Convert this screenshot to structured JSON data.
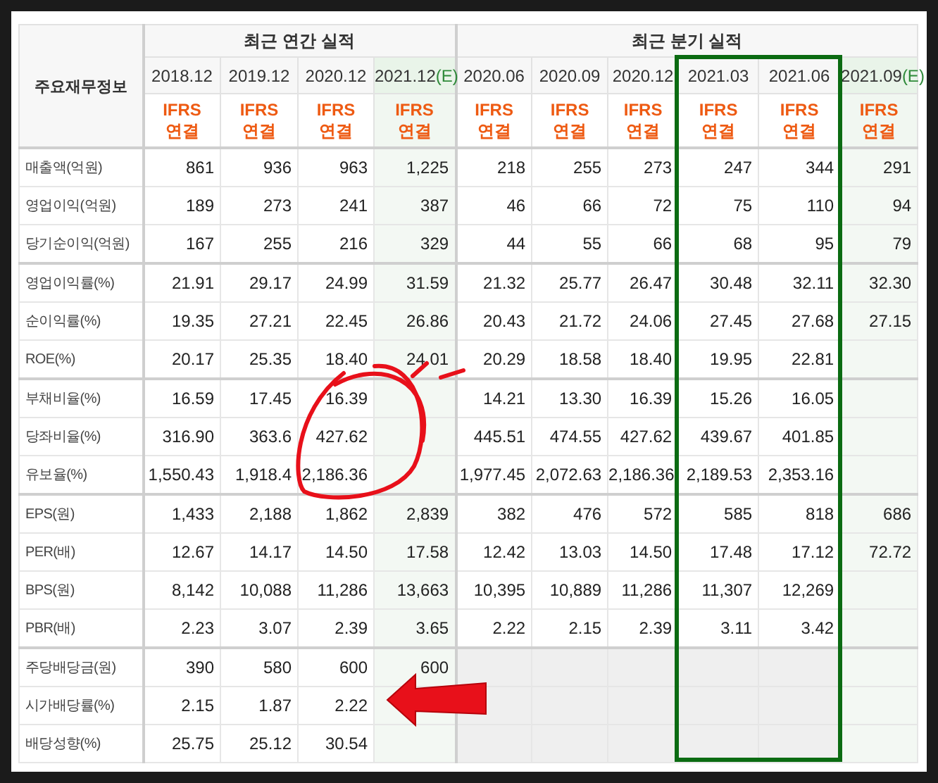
{
  "table": {
    "corner_label": "주요재무정보",
    "groups": [
      {
        "label": "최근 연간 실적",
        "columns": [
          {
            "period": "2018.12",
            "basis": "IFRS",
            "scope": "연결"
          },
          {
            "period": "2019.12",
            "basis": "IFRS",
            "scope": "연결"
          },
          {
            "period": "2020.12",
            "basis": "IFRS",
            "scope": "연결"
          },
          {
            "period": "2021.12",
            "estimate": true,
            "estimate_mark": "(E)",
            "basis": "IFRS",
            "scope": "연결"
          }
        ]
      },
      {
        "label": "최근 분기 실적",
        "columns": [
          {
            "period": "2020.06",
            "basis": "IFRS",
            "scope": "연결"
          },
          {
            "period": "2020.09",
            "basis": "IFRS",
            "scope": "연결"
          },
          {
            "period": "2020.12",
            "basis": "IFRS",
            "scope": "연결"
          },
          {
            "period": "2021.03",
            "boxed": true,
            "basis": "IFRS",
            "scope": "연결"
          },
          {
            "period": "2021.06",
            "boxed": true,
            "basis": "IFRS",
            "scope": "연결"
          },
          {
            "period": "2021.09",
            "estimate": true,
            "estimate_mark": "(E)",
            "basis": "IFRS",
            "scope": "연결"
          }
        ]
      }
    ],
    "sections": [
      {
        "rows": [
          {
            "label": "매출액(억원)",
            "values": [
              [
                "861",
                "936",
                "963",
                "1,225"
              ],
              [
                "218",
                "255",
                "273",
                "247",
                "344",
                "291"
              ]
            ]
          },
          {
            "label": "영업이익(억원)",
            "values": [
              [
                "189",
                "273",
                "241",
                "387"
              ],
              [
                "46",
                "66",
                "72",
                "75",
                "110",
                "94"
              ]
            ]
          },
          {
            "label": "당기순이익(억원)",
            "values": [
              [
                "167",
                "255",
                "216",
                "329"
              ],
              [
                "44",
                "55",
                "66",
                "68",
                "95",
                "79"
              ]
            ]
          }
        ]
      },
      {
        "rows": [
          {
            "label": "영업이익률(%)",
            "values": [
              [
                "21.91",
                "29.17",
                "24.99",
                "31.59"
              ],
              [
                "21.32",
                "25.77",
                "26.47",
                "30.48",
                "32.11",
                "32.30"
              ]
            ]
          },
          {
            "label": "순이익률(%)",
            "values": [
              [
                "19.35",
                "27.21",
                "22.45",
                "26.86"
              ],
              [
                "20.43",
                "21.72",
                "24.06",
                "27.45",
                "27.68",
                "27.15"
              ]
            ]
          },
          {
            "label": "ROE(%)",
            "values": [
              [
                "20.17",
                "25.35",
                "18.40",
                "24.01"
              ],
              [
                "20.29",
                "18.58",
                "18.40",
                "19.95",
                "22.81"
              ]
            ]
          }
        ]
      },
      {
        "rows": [
          {
            "label": "부채비율(%)",
            "values": [
              [
                "16.59",
                "17.45",
                "16.39"
              ],
              [
                "14.21",
                "13.30",
                "16.39",
                "15.26",
                "16.05"
              ]
            ]
          },
          {
            "label": "당좌비율(%)",
            "values": [
              [
                "316.90",
                "363.6",
                "427.62"
              ],
              [
                "445.51",
                "474.55",
                "427.62",
                "439.67",
                "401.85"
              ]
            ]
          },
          {
            "label": "유보율(%)",
            "values": [
              [
                "1,550.43",
                "1,918.4",
                "2,186.36"
              ],
              [
                "1,977.45",
                "2,072.63",
                "2,186.36",
                "2,189.53",
                "2,353.16"
              ]
            ]
          }
        ]
      },
      {
        "rows": [
          {
            "label": "EPS(원)",
            "values": [
              [
                "1,433",
                "2,188",
                "1,862",
                "2,839"
              ],
              [
                "382",
                "476",
                "572",
                "585",
                "818",
                "686"
              ]
            ]
          },
          {
            "label": "PER(배)",
            "values": [
              [
                "12.67",
                "14.17",
                "14.50",
                "17.58"
              ],
              [
                "12.42",
                "13.03",
                "14.50",
                "17.48",
                "17.12",
                "72.72"
              ]
            ]
          },
          {
            "label": "BPS(원)",
            "values": [
              [
                "8,142",
                "10,088",
                "11,286",
                "13,663"
              ],
              [
                "10,395",
                "10,889",
                "11,286",
                "11,307",
                "12,269"
              ]
            ]
          },
          {
            "label": "PBR(배)",
            "values": [
              [
                "2.23",
                "3.07",
                "2.39",
                "3.65"
              ],
              [
                "2.22",
                "2.15",
                "2.39",
                "3.11",
                "3.42"
              ]
            ]
          }
        ]
      },
      {
        "shaded": true,
        "rows": [
          {
            "label": "주당배당금(원)",
            "values": [
              [
                "390",
                "580",
                "600",
                "600"
              ]
            ]
          },
          {
            "label": "시가배당률(%)",
            "values": [
              [
                "2.15",
                "1.87",
                "2.22"
              ]
            ]
          },
          {
            "label": "배당성향(%)",
            "values": [
              [
                "25.75",
                "25.12",
                "30.54"
              ]
            ]
          }
        ]
      }
    ]
  }
}
